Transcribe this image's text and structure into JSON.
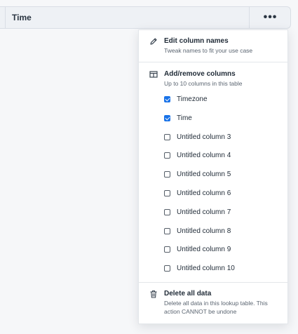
{
  "header": {
    "title": "Time",
    "more_label": "•••"
  },
  "menu": {
    "edit": {
      "title": "Edit column names",
      "subtitle": "Tweak names to fit your use case"
    },
    "columns": {
      "title": "Add/remove columns",
      "subtitle": "Up to 10 columns in this table",
      "items": [
        {
          "label": "Timezone",
          "checked": true
        },
        {
          "label": "Time",
          "checked": true
        },
        {
          "label": "Untitled column 3",
          "checked": false
        },
        {
          "label": "Untitled column 4",
          "checked": false
        },
        {
          "label": "Untitled column 5",
          "checked": false
        },
        {
          "label": "Untitled column 6",
          "checked": false
        },
        {
          "label": "Untitled column 7",
          "checked": false
        },
        {
          "label": "Untitled column 8",
          "checked": false
        },
        {
          "label": "Untitled column 9",
          "checked": false
        },
        {
          "label": "Untitled column 10",
          "checked": false
        }
      ]
    },
    "delete": {
      "title": "Delete all data",
      "subtitle_line1": "Delete all data in this lookup table. This",
      "subtitle_line2": "action CANNOT be undone"
    }
  }
}
